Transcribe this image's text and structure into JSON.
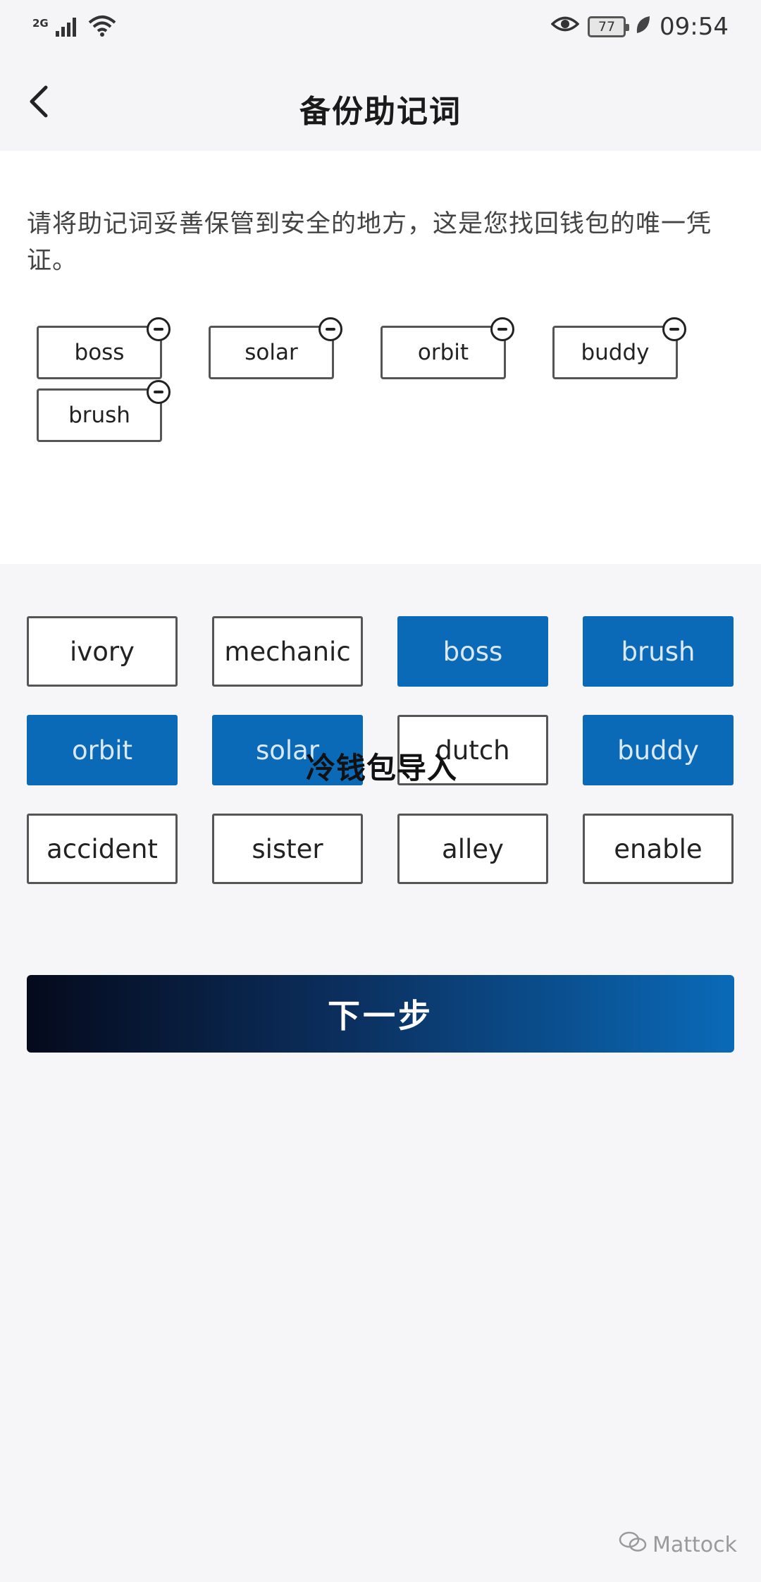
{
  "status_bar": {
    "network": "2G",
    "battery": "77",
    "time": "09:54"
  },
  "header": {
    "title": "备份助记词"
  },
  "notice": "请将助记词妥善保管到安全的地方，这是您找回钱包的唯一凭证。",
  "selected_words": [
    "boss",
    "solar",
    "orbit",
    "buddy",
    "brush"
  ],
  "word_grid": [
    {
      "label": "ivory",
      "selected": false
    },
    {
      "label": "mechanic",
      "selected": false
    },
    {
      "label": "boss",
      "selected": true
    },
    {
      "label": "brush",
      "selected": true
    },
    {
      "label": "orbit",
      "selected": true
    },
    {
      "label": "solar",
      "selected": true
    },
    {
      "label": "dutch",
      "selected": false
    },
    {
      "label": "buddy",
      "selected": true
    },
    {
      "label": "accident",
      "selected": false
    },
    {
      "label": "sister",
      "selected": false
    },
    {
      "label": "alley",
      "selected": false
    },
    {
      "label": "enable",
      "selected": false
    }
  ],
  "overlay_text": "冷钱包导入",
  "next_button": "下一步",
  "watermark": "Mattock",
  "colors": {
    "selected_word_bg": "#0a6ab8",
    "button_gradient_start": "#050a1c",
    "button_gradient_end": "#0a6ab8"
  }
}
